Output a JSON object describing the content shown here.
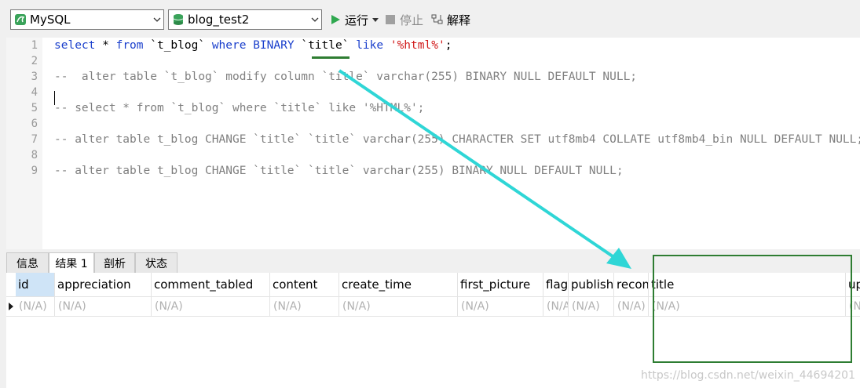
{
  "toolbar": {
    "connection": "MySQL",
    "database": "blog_test2",
    "run_label": "运行",
    "stop_label": "停止",
    "explain_label": "解释"
  },
  "editor": {
    "line_numbers": [
      "1",
      "2",
      "3",
      "4",
      "5",
      "6",
      "7",
      "8",
      "9"
    ],
    "line1": {
      "t1": "select",
      "t2": " * ",
      "t3": "from",
      "t4": " `t_blog` ",
      "t5": "where",
      "t6": " ",
      "t7": "BINARY",
      "t8": " `title` ",
      "t9": "like",
      "t10": " ",
      "t11": "'%html%'",
      "t12": ";"
    },
    "line3": "--  alter table `t_blog` modify column `title` varchar(255) BINARY NULL DEFAULT NULL;",
    "line5": "-- select * from `t_blog` where `title` like '%HTML%';",
    "line7": "-- alter table t_blog CHANGE `title` `title` varchar(255) CHARACTER SET utf8mb4 COLLATE utf8mb4_bin NULL DEFAULT NULL;",
    "line9": "-- alter table t_blog CHANGE `title` `title` varchar(255) BINARY NULL DEFAULT NULL;"
  },
  "tabs": [
    "信息",
    "结果 1",
    "剖析",
    "状态"
  ],
  "grid": {
    "columns": [
      "id",
      "appreciation",
      "comment_tabled",
      "content",
      "create_time",
      "first_picture",
      "flag",
      "publish",
      "recom",
      "title",
      "up"
    ],
    "row": [
      "(N/A)",
      "(N/A)",
      "(N/A)",
      "(N/A)",
      "(N/A)",
      "(N/A)",
      "(N/A)",
      "(N/A)",
      "(N/A)",
      "(N/A)",
      "(N"
    ]
  },
  "watermark": "https://blog.csdn.net/weixin_44694201",
  "colors": {
    "keyword": "#1a3fcc",
    "string": "#d11a1a",
    "comment": "#808080",
    "highlight_box": "#2e7d32",
    "arrow": "#2fd6d6"
  }
}
